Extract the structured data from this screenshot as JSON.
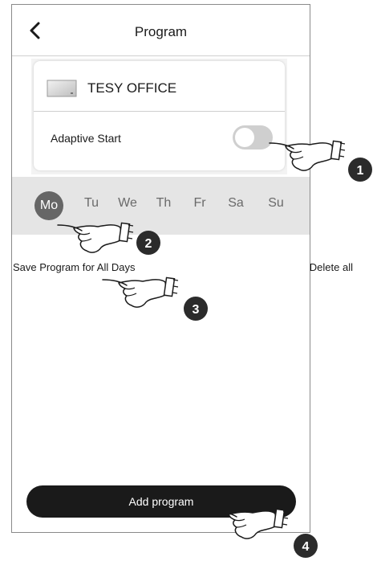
{
  "header": {
    "title": "Program",
    "back_icon": "chevron-left-icon"
  },
  "device": {
    "name": "TESY OFFICE",
    "icon": "heater-panel-icon"
  },
  "adaptive_start": {
    "label": "Adaptive Start",
    "enabled": false
  },
  "days": {
    "items": [
      "Mo",
      "Tu",
      "We",
      "Th",
      "Fr",
      "Sa",
      "Su"
    ],
    "selected": "Mo",
    "selected_color": "#666666"
  },
  "actions": {
    "save_all": "Save Program for All Days",
    "delete_all": "Delete all"
  },
  "add_button": {
    "label": "Add program",
    "color": "#1a1a1a"
  },
  "callouts": [
    "1",
    "2",
    "3",
    "4"
  ]
}
